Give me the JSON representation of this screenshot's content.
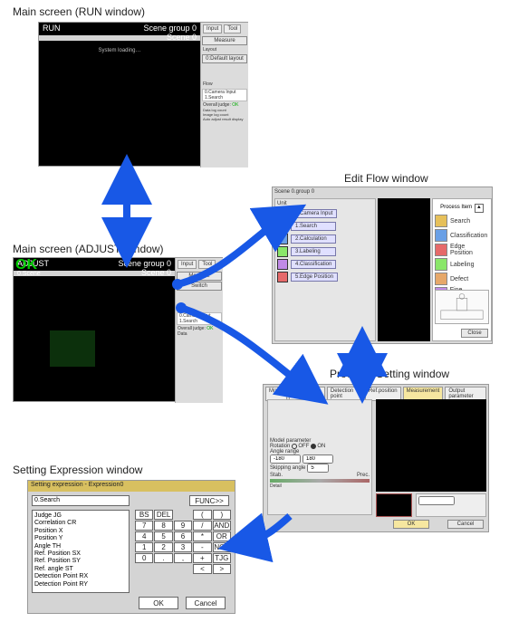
{
  "labels": {
    "run": "Main screen (RUN window)",
    "adjust": "Main screen (ADJUST window)",
    "editflow": "Edit Flow window",
    "procitem": "ProcItem Setting window",
    "expr": "Setting Expression window"
  },
  "run": {
    "title": "RUN",
    "scene_group": "Scene group 0",
    "scene": "Scene 0",
    "status": "System loading…",
    "side": {
      "tab1": "Input",
      "tab2": "Tool",
      "measure": "Measure",
      "layout": "Layout",
      "current_layout": "0:Default layout",
      "flow_hdr": "Flow",
      "flow0": "0.Camera Input",
      "flow1": "1.Search",
      "overall": "Overall judge",
      "judge": "OK",
      "data_log": "Data log count",
      "img_log": "Image log count",
      "auto_adj": "Auto adjust result display"
    }
  },
  "adjust": {
    "ok": "OK",
    "title": "ADJUST",
    "subtitle": "0.Scene",
    "scene_group": "Scene group 0",
    "scene": "Scene 0",
    "side": {
      "tab1": "Input",
      "tab2": "Tool",
      "measure": "Measure",
      "switch": "Switch",
      "flow_hdr": "Flow",
      "flow0": "0.Camera Input",
      "flow1": "1.Search",
      "overall": "Overall judge",
      "judge": "OK",
      "data": "Data"
    }
  },
  "editflow": {
    "title": "Scene 0.group 0",
    "left_hdr": "Unit",
    "units": [
      "0.Camera Input",
      "1.Search",
      "2.Calculation",
      "3.Labeling",
      "4.Classification",
      "5.Edge Position"
    ],
    "right_hdr": "Process Item",
    "folder_up": "▲",
    "browser": [
      {
        "name": "Search",
        "color": "#e6c05a"
      },
      {
        "name": "Classification",
        "color": "#6aa0e6"
      },
      {
        "name": "Edge Position",
        "color": "#e66a6a"
      },
      {
        "name": "Labeling",
        "color": "#8ae66a"
      },
      {
        "name": "Defect",
        "color": "#e6a86a"
      },
      {
        "name": "Fine Matching",
        "color": "#c08ae6"
      }
    ],
    "close": "Close"
  },
  "procitem": {
    "tabs": [
      "Model",
      "Region Setting",
      "Detection point",
      "Ref.position",
      "Measurement",
      "Output parameter"
    ],
    "model_param": "Model parameter",
    "rotation": "Rotation",
    "rot_off": "OFF",
    "rot_on": "ON",
    "angle_range": "Angle range",
    "angle_lo": "-180",
    "angle_hi": "180",
    "skip": "Skipping angle",
    "skip_v": "5",
    "stab": "Stab.",
    "prec": "Prec.",
    "sub_hdr": "Detail",
    "ok": "OK",
    "cancel": "Cancel"
  },
  "expr": {
    "title": "Setting expression - Expression0",
    "unit_sel": "0.Search",
    "func_btn": "FUNC>>",
    "items": [
      "Judge JG",
      "Correlation CR",
      "Position X",
      "Position Y",
      "Angle TH",
      "Ref. Position SX",
      "Ref. Position SY",
      "Ref. angle ST",
      "Detection Point RX",
      "Detection Point RY"
    ],
    "bs": "BS",
    "del": "DEL",
    "lp": "(",
    "rp": ")",
    "k7": "7",
    "k8": "8",
    "k9": "9",
    "div": "/",
    "and": "AND",
    "k4": "4",
    "k5": "5",
    "k6": "6",
    "mul": "*",
    "or": "OR",
    "k1": "1",
    "k2": "2",
    "k3": "3",
    "sub": "-",
    "not": "NOT",
    "k0": "0",
    "dot": ".",
    "comma": ",",
    "add": "+",
    "tjg": "TJG",
    "lt": "<",
    "gt": ">",
    "ok": "OK",
    "cancel": "Cancel"
  }
}
